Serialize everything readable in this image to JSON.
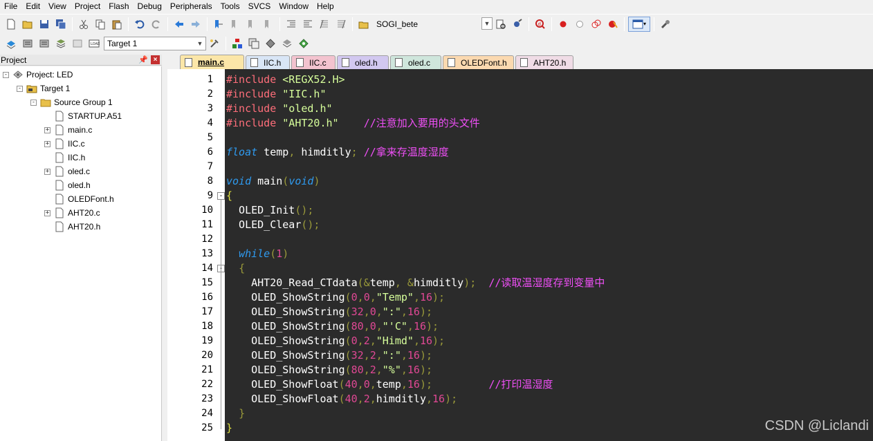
{
  "menu": [
    "File",
    "Edit",
    "View",
    "Project",
    "Flash",
    "Debug",
    "Peripherals",
    "Tools",
    "SVCS",
    "Window",
    "Help"
  ],
  "toolbar": {
    "target_combo": "SOGI_bete",
    "build_target": "Target 1"
  },
  "project_panel": {
    "title": "Project",
    "tree": [
      {
        "label": "Project: LED",
        "level": 0,
        "expander": "-",
        "icon": "project-icon"
      },
      {
        "label": "Target 1",
        "level": 1,
        "expander": "-",
        "icon": "target-icon"
      },
      {
        "label": "Source Group 1",
        "level": 2,
        "expander": "-",
        "icon": "folder-icon"
      },
      {
        "label": "STARTUP.A51",
        "level": 3,
        "expander": "",
        "icon": "file-icon"
      },
      {
        "label": "main.c",
        "level": 3,
        "expander": "+",
        "icon": "file-icon"
      },
      {
        "label": "IIC.c",
        "level": 3,
        "expander": "+",
        "icon": "file-icon"
      },
      {
        "label": "IIC.h",
        "level": 3,
        "expander": "",
        "icon": "file-icon"
      },
      {
        "label": "oled.c",
        "level": 3,
        "expander": "+",
        "icon": "file-icon"
      },
      {
        "label": "oled.h",
        "level": 3,
        "expander": "",
        "icon": "file-icon"
      },
      {
        "label": "OLEDFont.h",
        "level": 3,
        "expander": "",
        "icon": "file-icon"
      },
      {
        "label": "AHT20.c",
        "level": 3,
        "expander": "+",
        "icon": "file-icon"
      },
      {
        "label": "AHT20.h",
        "level": 3,
        "expander": "",
        "icon": "file-icon"
      }
    ]
  },
  "tabs": [
    {
      "label": "main.c",
      "color": "#fbe6a8",
      "active": true
    },
    {
      "label": "IIC.h",
      "color": "#d9e6f6"
    },
    {
      "label": "IIC.c",
      "color": "#f3c3cf"
    },
    {
      "label": "oled.h",
      "color": "#d2c8f0"
    },
    {
      "label": "oled.c",
      "color": "#cfe6dc"
    },
    {
      "label": "OLEDFont.h",
      "color": "#fbd9b0"
    },
    {
      "label": "AHT20.h",
      "color": "#f0dce6"
    }
  ],
  "code_lines": [
    {
      "n": "1",
      "tokens": [
        [
          "pp",
          "#include "
        ],
        [
          "inc",
          "<REGX52.H>"
        ]
      ]
    },
    {
      "n": "2",
      "tokens": [
        [
          "pp",
          "#include "
        ],
        [
          "str",
          "\"IIC.h\""
        ]
      ]
    },
    {
      "n": "3",
      "tokens": [
        [
          "pp",
          "#include "
        ],
        [
          "str",
          "\"oled.h\""
        ]
      ]
    },
    {
      "n": "4",
      "tokens": [
        [
          "pp",
          "#include "
        ],
        [
          "str",
          "\"AHT20.h\""
        ],
        [
          "id",
          "    "
        ],
        [
          "cm",
          "//注意加入要用的头文件"
        ]
      ]
    },
    {
      "n": "5",
      "tokens": []
    },
    {
      "n": "6",
      "tokens": [
        [
          "kw",
          "float"
        ],
        [
          "id",
          " temp"
        ],
        [
          "pu",
          ","
        ],
        [
          "id",
          " himditly"
        ],
        [
          "pu",
          ";"
        ],
        [
          "id",
          " "
        ],
        [
          "cm",
          "//拿来存温度湿度"
        ]
      ]
    },
    {
      "n": "7",
      "tokens": []
    },
    {
      "n": "8",
      "tokens": [
        [
          "kw",
          "void"
        ],
        [
          "id",
          " main"
        ],
        [
          "pu",
          "("
        ],
        [
          "kw",
          "void"
        ],
        [
          "pu",
          ")"
        ]
      ]
    },
    {
      "n": "9",
      "tokens": [
        [
          "brace",
          "{"
        ]
      ],
      "fold": "-"
    },
    {
      "n": "10",
      "tokens": [
        [
          "id",
          "  OLED_Init"
        ],
        [
          "pu",
          "();"
        ]
      ]
    },
    {
      "n": "11",
      "tokens": [
        [
          "id",
          "  OLED_Clear"
        ],
        [
          "pu",
          "();"
        ]
      ]
    },
    {
      "n": "12",
      "tokens": []
    },
    {
      "n": "13",
      "tokens": [
        [
          "id",
          "  "
        ],
        [
          "kw",
          "while"
        ],
        [
          "pu",
          "("
        ],
        [
          "num",
          "1"
        ],
        [
          "pu",
          ")"
        ]
      ]
    },
    {
      "n": "14",
      "tokens": [
        [
          "id",
          "  "
        ],
        [
          "pu",
          "{"
        ]
      ],
      "fold": "-"
    },
    {
      "n": "15",
      "tokens": [
        [
          "id",
          "    AHT20_Read_CTdata"
        ],
        [
          "pu",
          "(&"
        ],
        [
          "id",
          "temp"
        ],
        [
          "pu",
          ", &"
        ],
        [
          "id",
          "himditly"
        ],
        [
          "pu",
          ");"
        ],
        [
          "id",
          "  "
        ],
        [
          "cm",
          "//读取温湿度存到变量中"
        ]
      ]
    },
    {
      "n": "16",
      "tokens": [
        [
          "id",
          "    OLED_ShowString"
        ],
        [
          "pu",
          "("
        ],
        [
          "num",
          "0"
        ],
        [
          "pu",
          ","
        ],
        [
          "num",
          "0"
        ],
        [
          "pu",
          ","
        ],
        [
          "str",
          "\"Temp\""
        ],
        [
          "pu",
          ","
        ],
        [
          "num",
          "16"
        ],
        [
          "pu",
          ");"
        ]
      ]
    },
    {
      "n": "17",
      "tokens": [
        [
          "id",
          "    OLED_ShowString"
        ],
        [
          "pu",
          "("
        ],
        [
          "num",
          "32"
        ],
        [
          "pu",
          ","
        ],
        [
          "num",
          "0"
        ],
        [
          "pu",
          ","
        ],
        [
          "str",
          "\":\""
        ],
        [
          "pu",
          ","
        ],
        [
          "num",
          "16"
        ],
        [
          "pu",
          ");"
        ]
      ]
    },
    {
      "n": "18",
      "tokens": [
        [
          "id",
          "    OLED_ShowString"
        ],
        [
          "pu",
          "("
        ],
        [
          "num",
          "80"
        ],
        [
          "pu",
          ","
        ],
        [
          "num",
          "0"
        ],
        [
          "pu",
          ","
        ],
        [
          "str",
          "\"'C\""
        ],
        [
          "pu",
          ","
        ],
        [
          "num",
          "16"
        ],
        [
          "pu",
          ");"
        ]
      ]
    },
    {
      "n": "19",
      "tokens": [
        [
          "id",
          "    OLED_ShowString"
        ],
        [
          "pu",
          "("
        ],
        [
          "num",
          "0"
        ],
        [
          "pu",
          ","
        ],
        [
          "num",
          "2"
        ],
        [
          "pu",
          ","
        ],
        [
          "str",
          "\"Himd\""
        ],
        [
          "pu",
          ","
        ],
        [
          "num",
          "16"
        ],
        [
          "pu",
          ");"
        ]
      ]
    },
    {
      "n": "20",
      "tokens": [
        [
          "id",
          "    OLED_ShowString"
        ],
        [
          "pu",
          "("
        ],
        [
          "num",
          "32"
        ],
        [
          "pu",
          ","
        ],
        [
          "num",
          "2"
        ],
        [
          "pu",
          ","
        ],
        [
          "str",
          "\":\""
        ],
        [
          "pu",
          ","
        ],
        [
          "num",
          "16"
        ],
        [
          "pu",
          ");"
        ]
      ]
    },
    {
      "n": "21",
      "tokens": [
        [
          "id",
          "    OLED_ShowString"
        ],
        [
          "pu",
          "("
        ],
        [
          "num",
          "80"
        ],
        [
          "pu",
          ","
        ],
        [
          "num",
          "2"
        ],
        [
          "pu",
          ","
        ],
        [
          "str",
          "\"%\""
        ],
        [
          "pu",
          ","
        ],
        [
          "num",
          "16"
        ],
        [
          "pu",
          ");"
        ]
      ]
    },
    {
      "n": "22",
      "tokens": [
        [
          "id",
          "    OLED_ShowFloat"
        ],
        [
          "pu",
          "("
        ],
        [
          "num",
          "40"
        ],
        [
          "pu",
          ","
        ],
        [
          "num",
          "0"
        ],
        [
          "pu",
          ","
        ],
        [
          "id",
          "temp"
        ],
        [
          "pu",
          ","
        ],
        [
          "num",
          "16"
        ],
        [
          "pu",
          ");"
        ],
        [
          "id",
          "         "
        ],
        [
          "cm",
          "//打印温湿度"
        ]
      ]
    },
    {
      "n": "23",
      "tokens": [
        [
          "id",
          "    OLED_ShowFloat"
        ],
        [
          "pu",
          "("
        ],
        [
          "num",
          "40"
        ],
        [
          "pu",
          ","
        ],
        [
          "num",
          "2"
        ],
        [
          "pu",
          ","
        ],
        [
          "id",
          "himditly"
        ],
        [
          "pu",
          ","
        ],
        [
          "num",
          "16"
        ],
        [
          "pu",
          ");"
        ]
      ]
    },
    {
      "n": "24",
      "tokens": [
        [
          "id",
          "  "
        ],
        [
          "pu",
          "}"
        ]
      ]
    },
    {
      "n": "25",
      "tokens": [
        [
          "brace",
          "}"
        ]
      ]
    }
  ],
  "watermark": "CSDN @Liclandi"
}
